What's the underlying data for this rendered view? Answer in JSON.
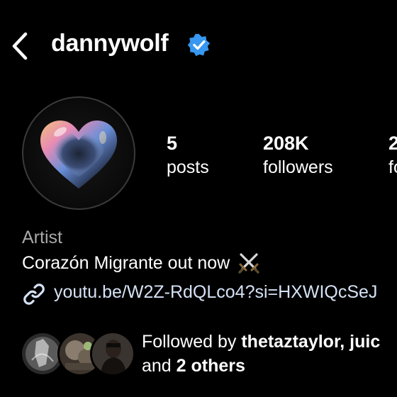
{
  "header": {
    "username": "dannywolf",
    "back_icon": "chevron-left-icon",
    "verified_icon": "verified-badge-icon",
    "verified_color": "#3897f0"
  },
  "profile": {
    "avatar_icon": "iridescent-heart-avatar",
    "stats": [
      {
        "value": "5",
        "label": "posts"
      },
      {
        "value": "208K",
        "label": "followers"
      },
      {
        "value": "2",
        "label": "fo"
      }
    ]
  },
  "bio": {
    "category": "Artist",
    "text": "Corazón Migrante out now",
    "emoji_icon": "crossed-swords-icon",
    "link_icon": "link-icon",
    "link": "youtu.be/W2Z-RdQLco4?si=HXWIQcSeJ"
  },
  "followed_by": {
    "prefix": "Followed by ",
    "names": "thetaztaylor, juic",
    "line2_prefix": "and ",
    "others": "2 others"
  },
  "colors": {
    "background": "#000000",
    "secondary_text": "#a8a8a8",
    "link_text": "#d4e2f5"
  }
}
